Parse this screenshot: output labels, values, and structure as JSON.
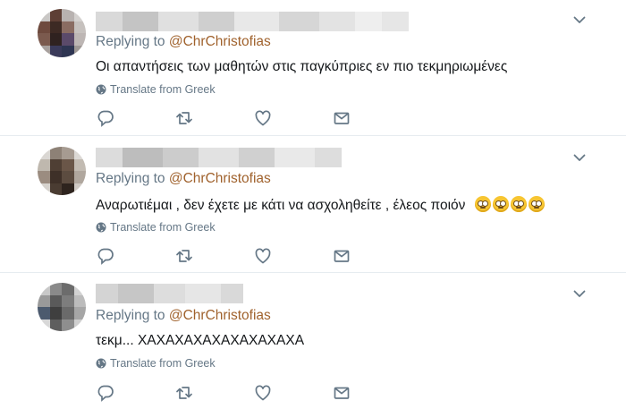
{
  "tweets": [
    {
      "replying_prefix": "Replying to ",
      "replying_handle": "@ChrChristofias",
      "text": "Οι απαντήσεις των μαθητών στις παγκύπριες εν πιο τεκμηριωμένες",
      "translate": "Translate from Greek",
      "emojis": []
    },
    {
      "replying_prefix": "Replying to ",
      "replying_handle": "@ChrChristofias",
      "text": "Αναρωτιέμαι , δεν έχετε με κάτι να ασχοληθείτε  , έλεος ποιόν",
      "translate": "Translate from Greek",
      "emojis": [
        "face-with-rolling-eyes",
        "face-with-rolling-eyes",
        "face-with-rolling-eyes",
        "face-with-rolling-eyes"
      ]
    },
    {
      "replying_prefix": "Replying to ",
      "replying_handle": "@ChrChristofias",
      "text": "τεκμ... ΧΑΧΑΧΑΧΑΧΑΧΑΧΑΧΑΧΑ",
      "translate": "Translate from Greek",
      "emojis": []
    }
  ],
  "icons": {
    "reply": "reply-icon",
    "retweet": "retweet-icon",
    "like": "like-icon",
    "dm": "direct-message-icon",
    "caret": "chevron-down-icon",
    "globe": "globe-icon"
  },
  "colors": {
    "handle": "#a0622d",
    "muted": "#657786",
    "text": "#14171a",
    "divider": "#e6ecf0"
  }
}
